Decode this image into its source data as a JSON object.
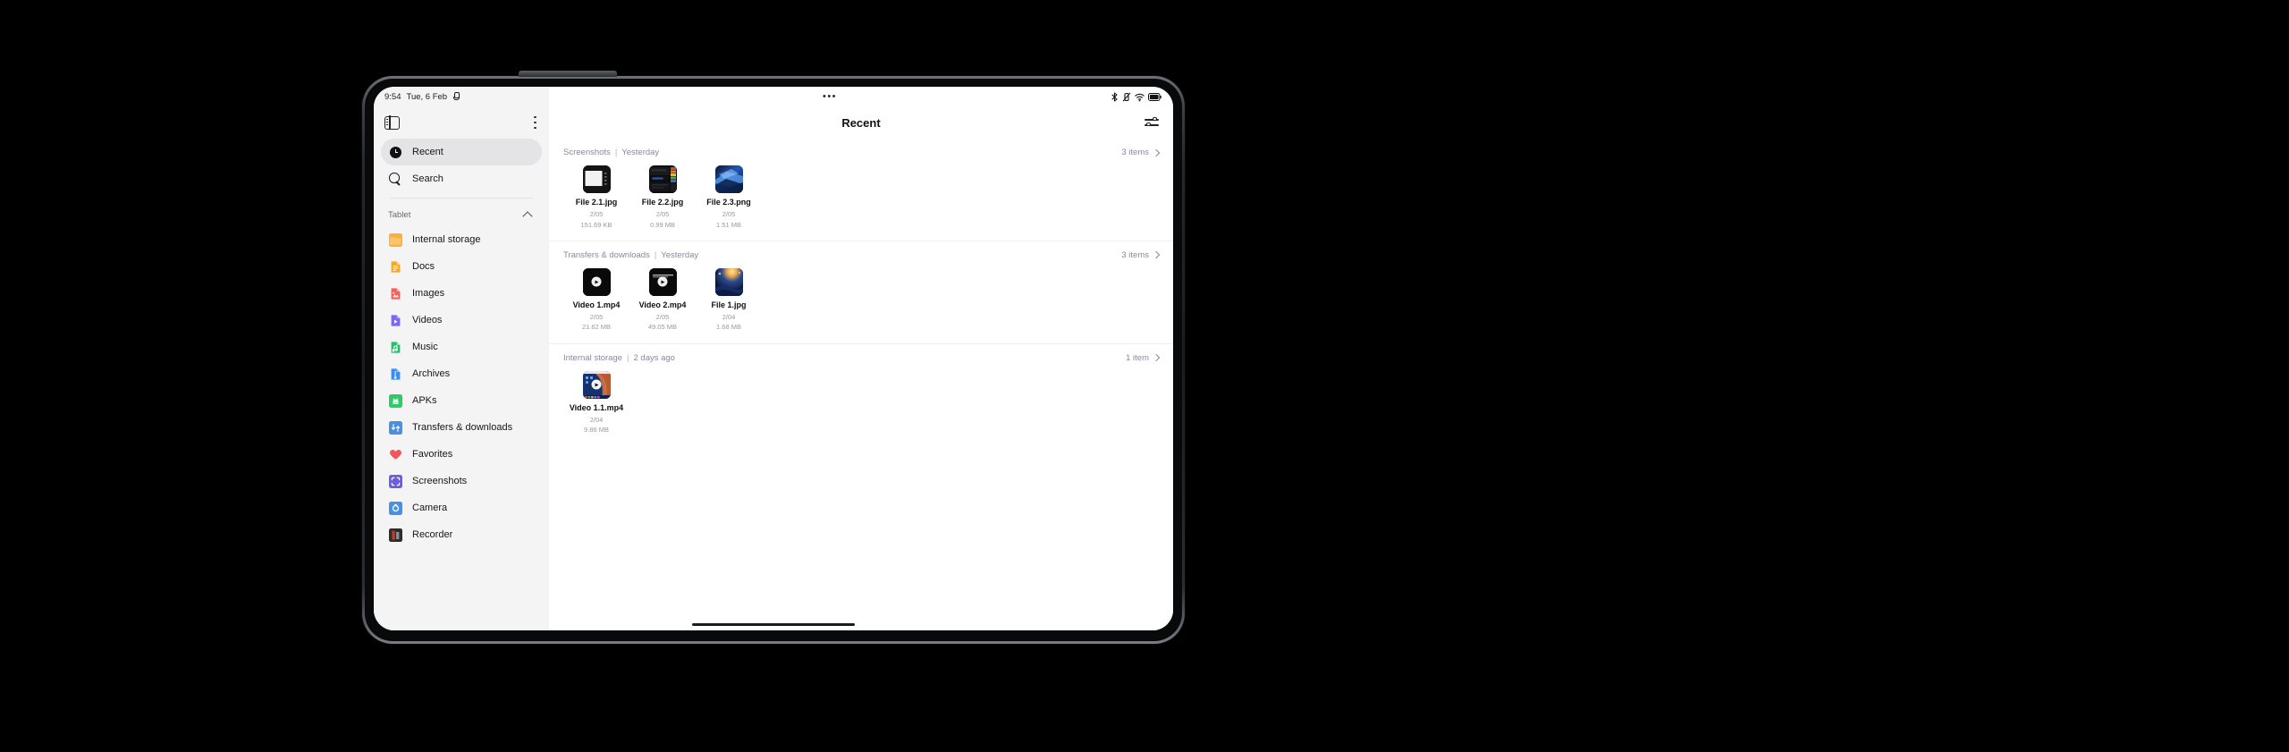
{
  "statusbar": {
    "time": "9:54",
    "date": "Tue, 6 Feb",
    "mic_icon": "mic-icon",
    "center_dots": "•••",
    "bluetooth_icon": "bluetooth-icon",
    "vibrate_icon": "vibrate-mode-icon",
    "wifi_icon": "wifi-icon",
    "battery_icon": "battery-icon"
  },
  "sidebar": {
    "panel_toggle_icon": "panel-toggle-icon",
    "overflow_icon": "kebab-menu-icon",
    "primary": [
      {
        "label": "Recent",
        "icon": "clock-icon",
        "selected": true
      },
      {
        "label": "Search",
        "icon": "search-icon",
        "selected": false
      }
    ],
    "group_label": "Tablet",
    "group_collapse_icon": "chevron-up-icon",
    "items": [
      {
        "label": "Internal storage",
        "icon": "folder-icon",
        "color": "#FBB03B"
      },
      {
        "label": "Docs",
        "icon": "document-icon",
        "color": "#F5A623"
      },
      {
        "label": "Images",
        "icon": "image-icon",
        "color": "#F2615C"
      },
      {
        "label": "Videos",
        "icon": "video-icon",
        "color": "#7B68EE"
      },
      {
        "label": "Music",
        "icon": "music-icon",
        "color": "#28BE6E"
      },
      {
        "label": "Archives",
        "icon": "archive-icon",
        "color": "#3C8DF0"
      },
      {
        "label": "APKs",
        "icon": "apk-icon",
        "color": "#2FCB6B"
      },
      {
        "label": "Transfers & downloads",
        "icon": "transfer-icon",
        "color": "#4A90E2"
      },
      {
        "label": "Favorites",
        "icon": "heart-icon",
        "color": "#F0565B"
      },
      {
        "label": "Screenshots",
        "icon": "screenshot-icon",
        "color": "#6C5CE7"
      },
      {
        "label": "Camera",
        "icon": "camera-icon",
        "color": "#4A90E2"
      },
      {
        "label": "Recorder",
        "icon": "recorder-icon",
        "color": "#3A3A3A"
      }
    ]
  },
  "content": {
    "title": "Recent",
    "tune_icon": "sort-filter-icon",
    "sections": [
      {
        "source": "Screenshots",
        "separator": "|",
        "when": "Yesterday",
        "count_label": "3 items",
        "chevron_icon": "chevron-right-icon",
        "files": [
          {
            "name": "File 2.1.jpg",
            "date": "2/05",
            "size": "151.69 KB",
            "thumb": "screenshot-window-thumb",
            "is_video": false
          },
          {
            "name": "File 2.2.jpg",
            "date": "2/05",
            "size": "0.99 MB",
            "thumb": "dark-ui-screenshot-thumb",
            "is_video": false
          },
          {
            "name": "File 2.3.png",
            "date": "2/05",
            "size": "1.51 MB",
            "thumb": "blue-abstract-thumb",
            "is_video": false
          }
        ]
      },
      {
        "source": "Transfers & downloads",
        "separator": "|",
        "when": "Yesterday",
        "count_label": "3 items",
        "chevron_icon": "chevron-right-icon",
        "files": [
          {
            "name": "Video 1.mp4",
            "date": "2/05",
            "size": "21.62 MB",
            "thumb": "black-video-thumb",
            "is_video": true
          },
          {
            "name": "Video 2.mp4",
            "date": "2/05",
            "size": "49.05 MB",
            "thumb": "black-video-text-thumb",
            "is_video": true
          },
          {
            "name": "File 1.jpg",
            "date": "2/04",
            "size": "1.68 MB",
            "thumb": "starry-night-thumb",
            "is_video": false
          }
        ]
      },
      {
        "source": "Internal storage",
        "separator": "|",
        "when": "2 days ago",
        "count_label": "1 item",
        "chevron_icon": "chevron-right-icon",
        "files": [
          {
            "name": "Video 1.1.mp4",
            "date": "2/04",
            "size": "9.86 MB",
            "thumb": "phone-screen-video-thumb",
            "is_video": true
          }
        ]
      }
    ]
  },
  "device": {
    "home_indicator": "home-indicator",
    "front_camera_icon": "front-camera-icon"
  }
}
